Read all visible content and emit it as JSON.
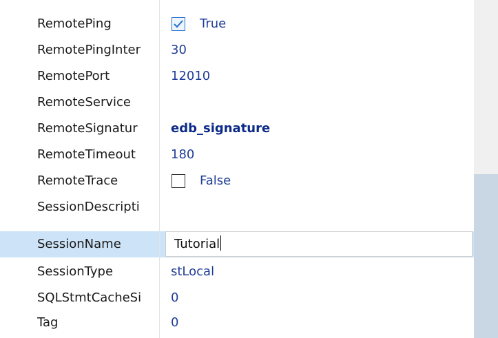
{
  "properties": [
    {
      "name": "RemotePing",
      "kind": "checkbox",
      "checked": true,
      "value": "True"
    },
    {
      "name": "RemotePingInter",
      "kind": "text",
      "value": "30"
    },
    {
      "name": "RemotePort",
      "kind": "text",
      "value": "12010"
    },
    {
      "name": "RemoteService",
      "kind": "text",
      "value": ""
    },
    {
      "name": "RemoteSignatur",
      "kind": "text",
      "value": "edb_signature",
      "bold": true
    },
    {
      "name": "RemoteTimeout",
      "kind": "text",
      "value": "180"
    },
    {
      "name": "RemoteTrace",
      "kind": "checkbox",
      "checked": false,
      "value": "False"
    },
    {
      "name": "SessionDescripti",
      "kind": "text",
      "value": ""
    },
    {
      "name": "SessionName",
      "kind": "editor",
      "value": "Tutorial",
      "selected": true
    },
    {
      "name": "SessionType",
      "kind": "text",
      "value": "stLocal"
    },
    {
      "name": "SQLStmtCacheSi",
      "kind": "text",
      "value": "0"
    },
    {
      "name": "Tag",
      "kind": "text",
      "value": "0"
    }
  ],
  "colors": {
    "selected_row": "#cde3f7",
    "value_text": "#1f3c96",
    "checkbox_accent": "#1e6fcf"
  }
}
